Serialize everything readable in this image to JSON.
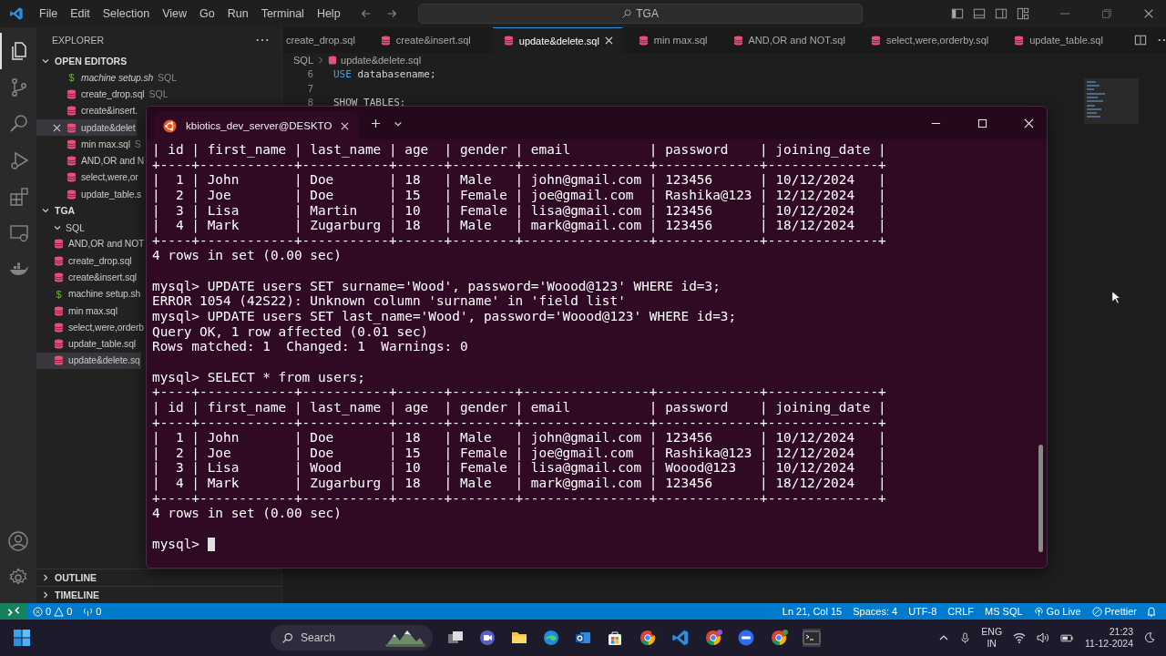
{
  "title_bar": {
    "menus": [
      "File",
      "Edit",
      "Selection",
      "View",
      "Go",
      "Run",
      "Terminal",
      "Help"
    ],
    "search": {
      "value": "TGA"
    }
  },
  "activity_bar": [
    {
      "kind": "explorer",
      "selected": true
    },
    {
      "kind": "source-control",
      "selected": false
    },
    {
      "kind": "search",
      "selected": false
    },
    {
      "kind": "run",
      "selected": false
    },
    {
      "kind": "extensions",
      "selected": false
    },
    {
      "kind": "remote",
      "selected": false
    },
    {
      "kind": "docker",
      "selected": false
    }
  ],
  "sidebar": {
    "title": "EXPLORER",
    "open_editors": {
      "title": "OPEN EDITORS",
      "expanded": true,
      "items": [
        {
          "kind": "sh",
          "glyph": "$",
          "name": "machine setup.sh",
          "suffix": "SQL",
          "preview": true,
          "selected": false
        },
        {
          "kind": "sql",
          "name": "create_drop.sql",
          "suffix": "SQL",
          "preview": false,
          "selected": false
        },
        {
          "kind": "sql",
          "name": "create&insert.",
          "preview": false,
          "selected": false
        },
        {
          "kind": "sql",
          "name": "update&delet",
          "preview": false,
          "selected": true
        },
        {
          "kind": "sql",
          "name": "min max.sql",
          "suffix": "S",
          "preview": false,
          "selected": false
        },
        {
          "kind": "sql",
          "name": "AND,OR and N",
          "preview": false,
          "selected": false
        },
        {
          "kind": "sql",
          "name": "select,were,or",
          "preview": false,
          "selected": false
        },
        {
          "kind": "sql",
          "name": "update_table.s",
          "preview": false,
          "selected": false
        }
      ]
    },
    "folder": {
      "title": "TGA",
      "expanded": true,
      "children": [
        {
          "name": "SQL",
          "expanded": true,
          "children": [
            {
              "kind": "sql",
              "name": "AND,OR and NOT",
              "selected": false
            },
            {
              "kind": "sql",
              "name": "create_drop.sql",
              "selected": false
            },
            {
              "kind": "sql",
              "name": "create&insert.sql",
              "selected": false
            },
            {
              "kind": "sh",
              "glyph": "$",
              "name": "machine setup.sh",
              "selected": false
            },
            {
              "kind": "sql",
              "name": "min max.sql",
              "selected": false
            },
            {
              "kind": "sql",
              "name": "select,were,orderb",
              "selected": false
            },
            {
              "kind": "sql",
              "name": "update_table.sql",
              "selected": false
            },
            {
              "kind": "sql",
              "name": "update&delete.sq",
              "selected": true
            }
          ]
        }
      ]
    },
    "outline": {
      "title": "OUTLINE",
      "expanded": false
    },
    "timeline": {
      "title": "TIMELINE",
      "expanded": false
    }
  },
  "editor": {
    "tabs": [
      {
        "name": "create_drop.sql",
        "selected": false,
        "icon": false
      },
      {
        "name": "create&insert.sql",
        "selected": false,
        "icon": true
      },
      {
        "name": "update&delete.sql",
        "selected": true,
        "icon": true
      },
      {
        "name": "min max.sql",
        "selected": false,
        "icon": true
      },
      {
        "name": "AND,OR and NOT.sql",
        "selected": false,
        "icon": true
      },
      {
        "name": "select,were,orderby.sql",
        "selected": false,
        "icon": true
      },
      {
        "name": "update_table.sql",
        "selected": false,
        "icon": true
      }
    ],
    "breadcrumb": [
      "SQL",
      "update&delete.sql"
    ],
    "code_lines": [
      {
        "number": "6",
        "keyword": "USE",
        "text": " databasename;"
      },
      {
        "number": "7"
      },
      {
        "number": "8",
        "text": "SHOW TABLES:"
      }
    ]
  },
  "terminal": {
    "tab_title": "kbiotics_dev_server@DESKTO",
    "prompt": "mysql>",
    "blocks": [
      [
        "| id | first_name | last_name | age  | gender | email          | password    | joining_date |",
        "+----+------------+-----------+------+--------+----------------+-------------+--------------+",
        "|  1 | John       | Doe       | 18   | Male   | john@gmail.com | 123456      | 10/12/2024   |",
        "|  2 | Joe        | Doe       | 15   | Female | joe@gmail.com  | Rashika@123 | 12/12/2024   |",
        "|  3 | Lisa       | Martin    | 10   | Female | lisa@gmail.com | 123456      | 10/12/2024   |",
        "|  4 | Mark       | Zugarburg | 18   | Male   | mark@gmail.com | 123456      | 18/12/2024   |",
        "+----+------------+-----------+------+--------+----------------+-------------+--------------+",
        "4 rows in set (0.00 sec)"
      ],
      [
        "mysql> UPDATE users SET surname='Wood', password='Woood@123' WHERE id=3;",
        "ERROR 1054 (42S22): Unknown column 'surname' in 'field list'",
        "mysql> UPDATE users SET last_name='Wood', password='Woood@123' WHERE id=3;",
        "Query OK, 1 row affected (0.01 sec)",
        "Rows matched: 1  Changed: 1  Warnings: 0"
      ],
      [
        "mysql> SELECT * from users;",
        "+----+------------+-----------+------+--------+----------------+-------------+--------------+",
        "| id | first_name | last_name | age  | gender | email          | password    | joining_date |",
        "+----+------------+-----------+------+--------+----------------+-------------+--------------+",
        "|  1 | John       | Doe       | 18   | Male   | john@gmail.com | 123456      | 10/12/2024   |",
        "|  2 | Joe        | Doe       | 15   | Female | joe@gmail.com  | Rashika@123 | 12/12/2024   |",
        "|  3 | Lisa       | Wood      | 10   | Female | lisa@gmail.com | Woood@123   | 10/12/2024   |",
        "|  4 | Mark       | Zugarburg | 18   | Male   | mark@gmail.com | 123456      | 18/12/2024   |",
        "+----+------------+-----------+------+--------+----------------+-------------+--------------+",
        "4 rows in set (0.00 sec)"
      ]
    ]
  },
  "status_bar": {
    "errors": "0",
    "warnings": "0",
    "ports": "0",
    "items": [
      "Ln 21, Col 15",
      "Spaces: 4",
      "UTF-8",
      "CRLF",
      "MS SQL"
    ],
    "go_live": "Go Live",
    "prettier": "Prettier"
  },
  "taskbar": {
    "search": {
      "placeholder": "Search"
    },
    "language": [
      "ENG",
      "IN"
    ],
    "time": "21:23",
    "date": "11-12-2024"
  }
}
